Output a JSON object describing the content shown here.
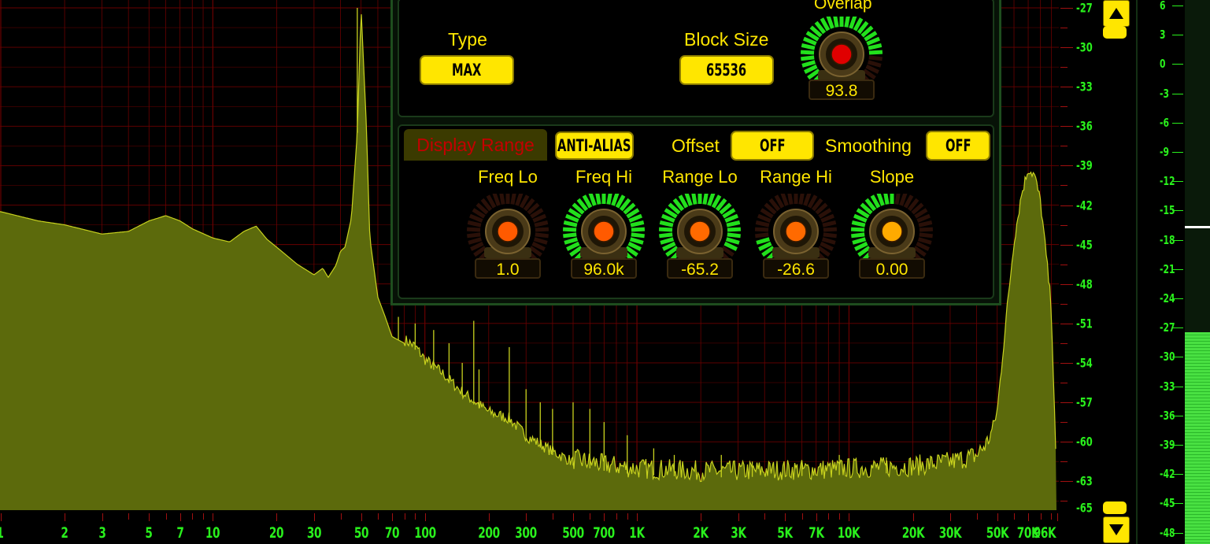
{
  "panel": {
    "type_label": "Type",
    "type_value": "MAX",
    "blocksize_label": "Block Size",
    "blocksize_value": "65536",
    "overlap_label": "Overlap",
    "overlap_value": "93.8",
    "overlap_level": 0.85,
    "display_range_tab": "Display Range",
    "antialias_label": "ANTI-ALIAS",
    "offset_label": "Offset",
    "offset_value": "OFF",
    "smoothing_label": "Smoothing",
    "smoothing_value": "OFF",
    "knobs": [
      {
        "label": "Freq Lo",
        "value": "1.0",
        "level": 0.0,
        "color": "#ff5a00"
      },
      {
        "label": "Freq Hi",
        "value": "96.0k",
        "level": 1.0,
        "color": "#ff5a00"
      },
      {
        "label": "Range Lo",
        "value": "-65.2",
        "level": 0.95,
        "color": "#ff6a00"
      },
      {
        "label": "Range Hi",
        "value": "-26.6",
        "level": 0.12,
        "color": "#ff6a00"
      },
      {
        "label": "Slope",
        "value": "0.00",
        "level": 0.5,
        "color": "#ffaa00"
      }
    ]
  },
  "colors": {
    "accent": "#ffe600",
    "scale_green": "#29f01c",
    "spectrum_fill": "#5c6a0c",
    "spectrum_line": "#c8d21e",
    "grid_red": "#6a0000",
    "knob_green": "#22e01c"
  },
  "x_ticks": [
    "1",
    "2",
    "3",
    "5",
    "7",
    "10",
    "20",
    "30",
    "50",
    "70",
    "100",
    "200",
    "300",
    "500",
    "700",
    "1K",
    "2K",
    "3K",
    "5K",
    "7K",
    "10K",
    "20K",
    "30K",
    "50K",
    "70K",
    "96K"
  ],
  "y_ticks": [
    "-27",
    "-30",
    "-33",
    "-36",
    "-39",
    "-42",
    "-45",
    "-48",
    "-51",
    "-54",
    "-57",
    "-60",
    "-63",
    "-65"
  ],
  "meter_ticks": [
    "6",
    "3",
    "0",
    "-3",
    "-6",
    "-9",
    "-12",
    "-15",
    "-18",
    "-21",
    "-24",
    "-27",
    "-30",
    "-33",
    "-36",
    "-39",
    "-42",
    "-45",
    "-48"
  ],
  "meter": {
    "level_fraction": 0.39,
    "peak_fraction": 0.585
  },
  "scroll": {
    "up_icon": "arrow-up-icon",
    "down_icon": "arrow-down-icon"
  },
  "chart_data": {
    "type": "area",
    "xlabel": "",
    "ylabel": "",
    "x_scale": "log",
    "xlim": [
      1,
      96000
    ],
    "ylim": [
      -65.2,
      -26.6
    ],
    "grid": true,
    "x": [
      1,
      1.5,
      2,
      3,
      4,
      5,
      6,
      7,
      8,
      10,
      12,
      14,
      16,
      18,
      20,
      25,
      30,
      33,
      35,
      38,
      40,
      42,
      45,
      48,
      50,
      53,
      55,
      60,
      65,
      70,
      80,
      90,
      100,
      120,
      150,
      200,
      250,
      300,
      400,
      500,
      700,
      1000,
      2000,
      3000,
      5000,
      7000,
      10000,
      15000,
      20000,
      30000,
      40000,
      45000,
      50000,
      55000,
      60000,
      65000,
      70000,
      75000,
      80000,
      85000,
      90000,
      96000
    ],
    "y": [
      -42.5,
      -43.2,
      -43.5,
      -44.2,
      -44.0,
      -43.2,
      -42.8,
      -43.2,
      -43.8,
      -44.5,
      -44.8,
      -44.0,
      -43.6,
      -44.6,
      -45.2,
      -46.5,
      -47.3,
      -46.8,
      -47.5,
      -46.6,
      -45.5,
      -45.2,
      -43.0,
      -36.5,
      -27.0,
      -36.0,
      -44.5,
      -49.0,
      -50.5,
      -52.0,
      -52.5,
      -53.0,
      -54.0,
      -55.0,
      -56.5,
      -58.0,
      -58.5,
      -59.8,
      -61.0,
      -61.8,
      -62.2,
      -62.5,
      -62.7,
      -62.7,
      -62.6,
      -62.6,
      -62.5,
      -62.4,
      -62.3,
      -62.0,
      -61.5,
      -60.5,
      -58.0,
      -51.0,
      -45.0,
      -41.5,
      -39.5,
      -40.0,
      -42.0,
      -46.0,
      -50.0,
      -65.2
    ],
    "peaks_x": [
      48,
      75,
      90,
      110,
      130,
      150,
      170,
      180,
      250,
      300,
      350,
      400,
      500,
      600,
      700,
      900,
      1200,
      1500,
      2500,
      3500,
      6000,
      9000,
      15000
    ],
    "peaks_y": [
      -27.0,
      -50.5,
      -51.0,
      -51.5,
      -52.5,
      -54.0,
      -50.8,
      -54.5,
      -52.8,
      -56.0,
      -57.0,
      -57.5,
      -57.0,
      -57.5,
      -58.5,
      -59.5,
      -60.5,
      -61.0,
      -61.0,
      -61.5,
      -61.5,
      -61.0,
      -61.2
    ]
  }
}
